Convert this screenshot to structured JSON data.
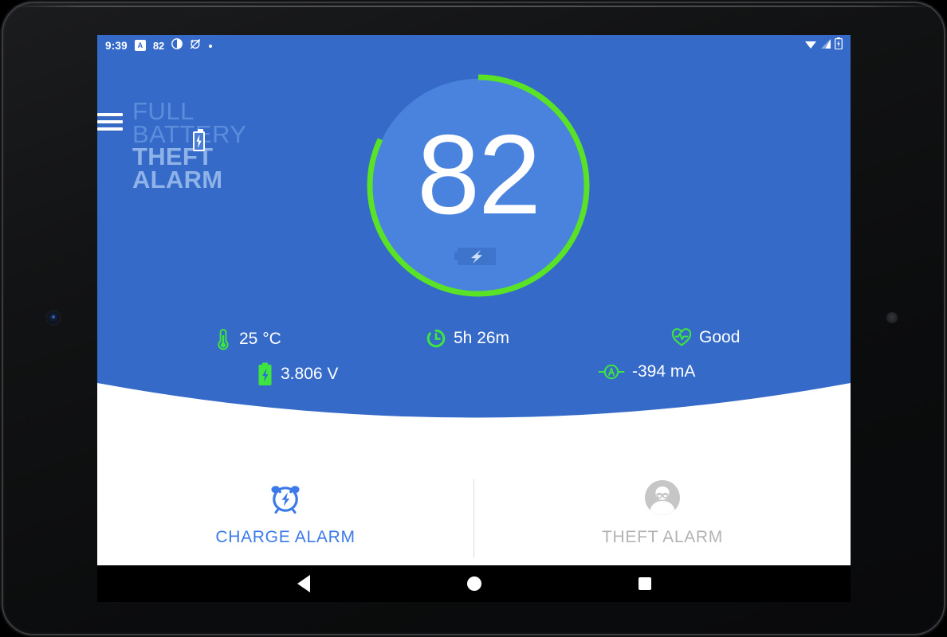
{
  "device": {
    "frame": "android-tablet",
    "camera_icon": "front-camera",
    "sensor_icon": "proximity-sensor"
  },
  "status_bar": {
    "time": "9:39",
    "badge_letter": "A",
    "battery_number": "82",
    "icons": [
      "brightness-icon",
      "alarm-off-icon",
      "dot-icon",
      "wifi-icon",
      "cellular-signal-icon",
      "battery-icon"
    ]
  },
  "brand": {
    "menu_icon": "hamburger-menu-icon",
    "line1": "FULL",
    "line2": "BATTERY",
    "line3": "THEFT",
    "line4": "ALARM",
    "battery_icon": "battery-bolt-icon"
  },
  "gauge": {
    "value": "82",
    "percent": 82,
    "unit": "%",
    "ring_color": "#5ae227",
    "track_color": "#4a83dd",
    "fill_color": "#4a83dd",
    "charging_icon": "battery-charging-icon"
  },
  "stats": [
    {
      "key": "temperature",
      "icon": "thermometer-icon",
      "value": "25 °C"
    },
    {
      "key": "time_remaining",
      "icon": "timer-icon",
      "value": "5h 26m"
    },
    {
      "key": "health",
      "icon": "heart-pulse-icon",
      "value": "Good"
    },
    {
      "key": "voltage",
      "icon": "battery-bolt-icon",
      "value": "3.806 V"
    },
    {
      "key": "current",
      "icon": "ammeter-icon",
      "value": "-394 mA"
    }
  ],
  "actions": {
    "charge": {
      "label": "CHARGE ALARM",
      "icon": "alarm-clock-bolt-icon",
      "color": "#3b7ae8",
      "enabled": true
    },
    "theft": {
      "label": "THEFT ALARM",
      "icon": "thief-avatar-icon",
      "color": "#b3b3b3",
      "enabled": false
    }
  },
  "nav_bar": {
    "back": "back-triangle-icon",
    "home": "home-circle-icon",
    "recents": "recents-square-icon"
  },
  "colors": {
    "header_blue": "#356ac9",
    "gauge_blue": "#4a83dd",
    "accent_green": "#5ae227",
    "action_blue": "#3b7ae8",
    "disabled_grey": "#b3b3b3"
  }
}
